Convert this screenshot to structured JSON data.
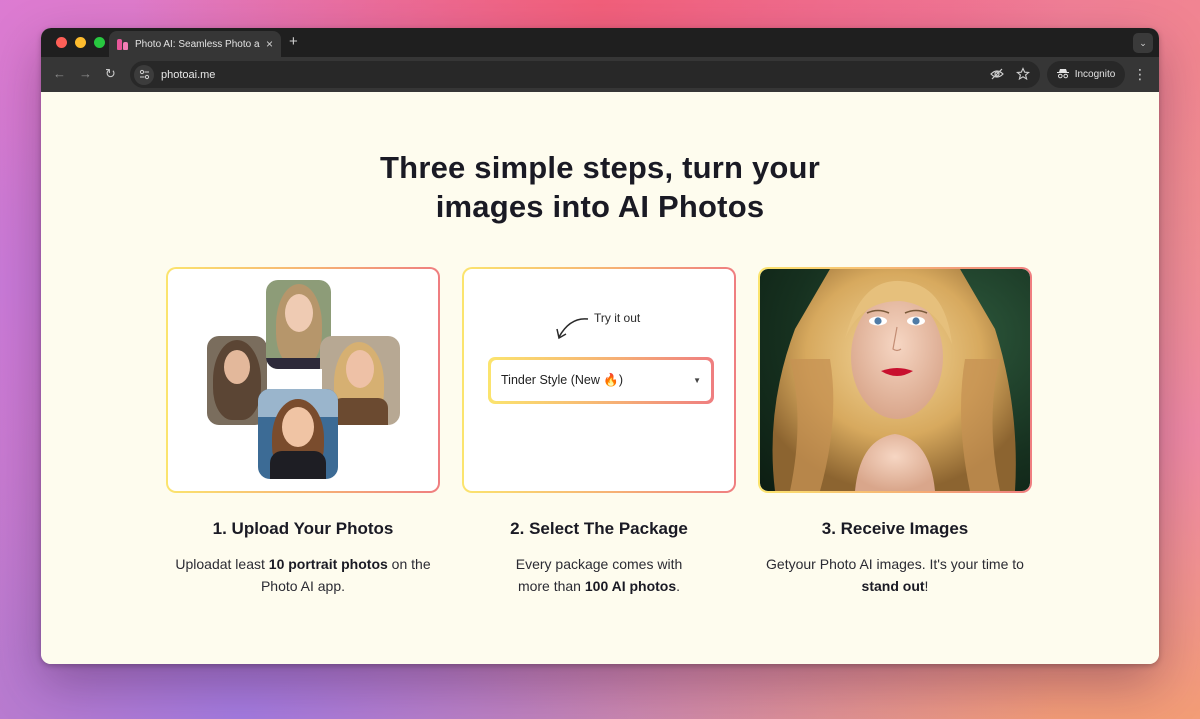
{
  "browser": {
    "tab_title": "Photo AI: Seamless Photo and",
    "tab_close": "×",
    "new_tab": "+",
    "url": "photoai.me",
    "incognito_label": "Incognito"
  },
  "page": {
    "headline_line1": "Three simple steps, turn your",
    "headline_line2": "images into AI Photos",
    "steps": [
      {
        "title": "1. Upload Your Photos",
        "desc_pre": "Uploadat least ",
        "desc_bold": "10 portrait photos",
        "desc_post": " on the Photo AI app."
      },
      {
        "title": "2. Select The Package",
        "desc_pre": "Every package comes with more than ",
        "desc_bold": "100 AI photos",
        "desc_post": "."
      },
      {
        "title": "3. Receive Images",
        "desc_pre": "Getyour Photo AI images. It's your time to ",
        "desc_bold": "stand out",
        "desc_post": "!"
      }
    ],
    "try_it_label": "Try it out",
    "package_select": {
      "selected": "Tinder Style (New 🔥)"
    }
  },
  "colors": {
    "page_bg": "#fefcee",
    "card_gradient_start": "#fbe46e",
    "card_gradient_end": "#ef7e80",
    "heading": "#1a1a24"
  },
  "icons": [
    "back-arrow-icon",
    "forward-arrow-icon",
    "reload-icon",
    "site-settings-icon",
    "eye-off-icon",
    "star-icon",
    "incognito-icon",
    "kebab-menu-icon",
    "chevron-down-icon",
    "curved-arrow-icon"
  ]
}
